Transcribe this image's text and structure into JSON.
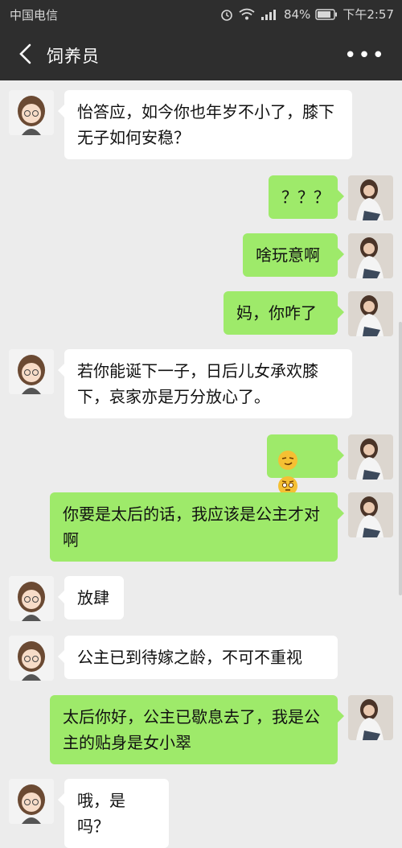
{
  "status_bar": {
    "carrier": "中国电信",
    "battery": "84%",
    "time": "下午2:57",
    "icons": [
      "alarm-icon",
      "wifi-icon",
      "signal-icon",
      "battery-icon"
    ]
  },
  "header": {
    "title": "饲养员",
    "back_icon": "chevron-left-icon",
    "more_icon": "more-icon",
    "more_label": "•••"
  },
  "messages": [
    {
      "side": "in",
      "text": "怡答应，如今你也年岁不小了，膝下无子如何安稳？"
    },
    {
      "side": "out",
      "text": "？？？"
    },
    {
      "side": "out",
      "text": "啥玩意啊"
    },
    {
      "side": "out",
      "text": "妈，你咋了"
    },
    {
      "side": "in",
      "text": "若你能诞下一子，日后儿女承欢膝下，哀家亦是万分放心了。"
    },
    {
      "side": "out",
      "text": "",
      "emojis": [
        "smirk-emoji-icon",
        "skeptical-emoji-icon"
      ]
    },
    {
      "side": "out",
      "text": "你要是太后的话，我应该是公主才对啊"
    },
    {
      "side": "in",
      "text": "放肆"
    },
    {
      "side": "in",
      "text": "公主已到待嫁之龄，不可不重视"
    },
    {
      "side": "out",
      "text": "太后你好，公主已歇息去了，我是公主的贴身是女小翠"
    },
    {
      "side": "in",
      "text": "哦，是吗？"
    }
  ],
  "colors": {
    "header_bg": "#2e2e2e",
    "chat_bg": "#ececec",
    "outgoing_bubble": "#9eea6a",
    "incoming_bubble": "#ffffff"
  }
}
